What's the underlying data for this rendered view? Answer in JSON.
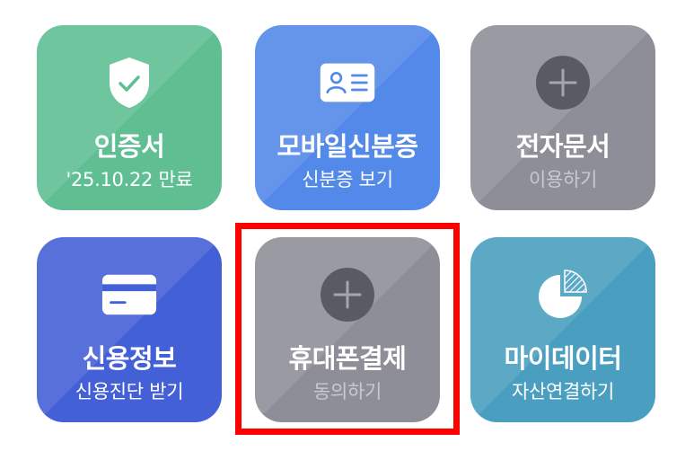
{
  "tiles": [
    {
      "title": "인증서",
      "subtitle": "'25.10.22 만료",
      "icon": "shield-check-icon",
      "color": "#5fbf93"
    },
    {
      "title": "모바일신분증",
      "subtitle": "신분증 보기",
      "icon": "id-card-icon",
      "color": "#5389e8"
    },
    {
      "title": "전자문서",
      "subtitle": "이용하기",
      "icon": "plus-circle-icon",
      "color": "#8e8e98"
    },
    {
      "title": "신용정보",
      "subtitle": "신용진단 받기",
      "icon": "credit-card-icon",
      "color": "#4460d6"
    },
    {
      "title": "휴대폰결제",
      "subtitle": "동의하기",
      "icon": "plus-circle-icon",
      "color": "#8e8e98"
    },
    {
      "title": "마이데이터",
      "subtitle": "자산연결하기",
      "icon": "pie-chart-icon",
      "color": "#4a9fc0"
    }
  ],
  "highlight": {
    "color": "#ff0000",
    "target": "휴대폰결제"
  }
}
